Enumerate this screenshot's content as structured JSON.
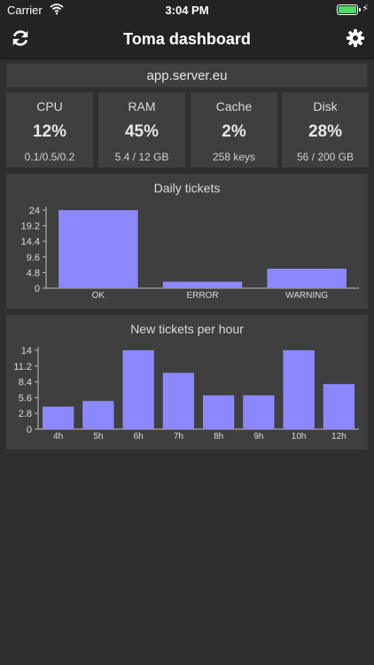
{
  "status_bar": {
    "carrier": "Carrier",
    "time": "3:04 PM"
  },
  "nav": {
    "title": "Toma dashboard",
    "left_icon": "refresh-icon",
    "right_icon": "gear-icon"
  },
  "server": {
    "host": "app.server.eu"
  },
  "stats": [
    {
      "label": "CPU",
      "value": "12%",
      "detail": "0.1/0.5/0.2"
    },
    {
      "label": "RAM",
      "value": "45%",
      "detail": "5.4 / 12 GB"
    },
    {
      "label": "Cache",
      "value": "2%",
      "detail": "258 keys"
    },
    {
      "label": "Disk",
      "value": "28%",
      "detail": "56 / 200 GB"
    }
  ],
  "colors": {
    "bar": "#8c88ff",
    "panel": "#3f3f3f",
    "background": "#2f2f2f",
    "battery": "#4cd964"
  },
  "chart_data": [
    {
      "type": "bar",
      "title": "Daily tickets",
      "categories": [
        "OK",
        "ERROR",
        "WARNING"
      ],
      "values": [
        24,
        2,
        6
      ],
      "ylim": [
        0,
        24
      ],
      "yticks": [
        "0",
        "4.8",
        "9.6",
        "14.4",
        "19.2",
        "24"
      ],
      "xlabel": "",
      "ylabel": ""
    },
    {
      "type": "bar",
      "title": "New tickets per hour",
      "categories": [
        "4h",
        "5h",
        "6h",
        "7h",
        "8h",
        "9h",
        "10h",
        "12h"
      ],
      "values": [
        4,
        5,
        14,
        10,
        6,
        6,
        14,
        8
      ],
      "ylim": [
        0,
        14
      ],
      "yticks": [
        "0",
        "2.8",
        "5.6",
        "8.4",
        "11.2",
        "14"
      ],
      "xlabel": "",
      "ylabel": ""
    }
  ]
}
